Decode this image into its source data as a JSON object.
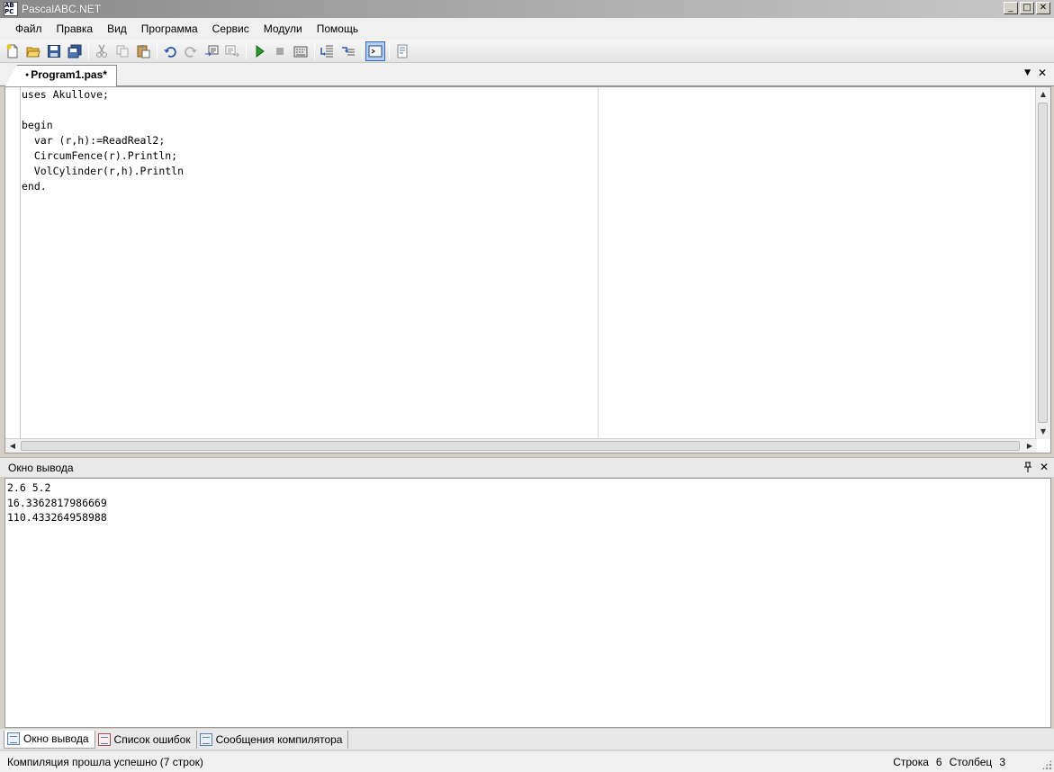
{
  "window": {
    "title": "PascalABC.NET",
    "icon": "pascalabc-app-icon",
    "icon_text": "AB PC",
    "controls": {
      "minimize": "_",
      "maximize": "□",
      "close": "✕"
    }
  },
  "menu": [
    "Файл",
    "Правка",
    "Вид",
    "Программа",
    "Сервис",
    "Модули",
    "Помощь"
  ],
  "toolbar": {
    "buttons": [
      "new-file-icon",
      "open-file-icon",
      "save-icon",
      "save-all-icon",
      "cut-icon",
      "copy-icon",
      "paste-icon",
      "undo-icon",
      "redo-icon",
      "comment-icon",
      "uncomment-icon",
      "run-icon",
      "stop-icon",
      "compile-icon",
      "step-into-icon",
      "step-over-icon",
      "console-icon",
      "format-icon"
    ],
    "active": "console-icon"
  },
  "tabs": {
    "active": {
      "label": "Program1.pas*",
      "modified_marker": "●"
    },
    "dropdown": "▼",
    "close": "✕"
  },
  "editor": {
    "lines": [
      "uses Akullove;",
      "",
      "begin",
      "  var (r,h):=ReadReal2;",
      "  CircumFence(r).Println;",
      "  VolCylinder(r,h).Println",
      "end."
    ]
  },
  "output_panel": {
    "title": "Окно вывода",
    "pin": "🖈",
    "close": "✕",
    "lines": [
      "2.6 5.2",
      "16.3362817986669",
      "110.433264958988"
    ]
  },
  "bottom_tabs": [
    {
      "label": "Окно вывода",
      "icon": "output-window-icon",
      "active": true
    },
    {
      "label": "Список ошибок",
      "icon": "error-list-icon",
      "active": false
    },
    {
      "label": "Сообщения компилятора",
      "icon": "compiler-messages-icon",
      "active": false
    }
  ],
  "status": {
    "message": "Компиляция прошла успешно (7 строк)",
    "row_label": "Строка",
    "row_value": "6",
    "col_label": "Столбец",
    "col_value": "3"
  }
}
